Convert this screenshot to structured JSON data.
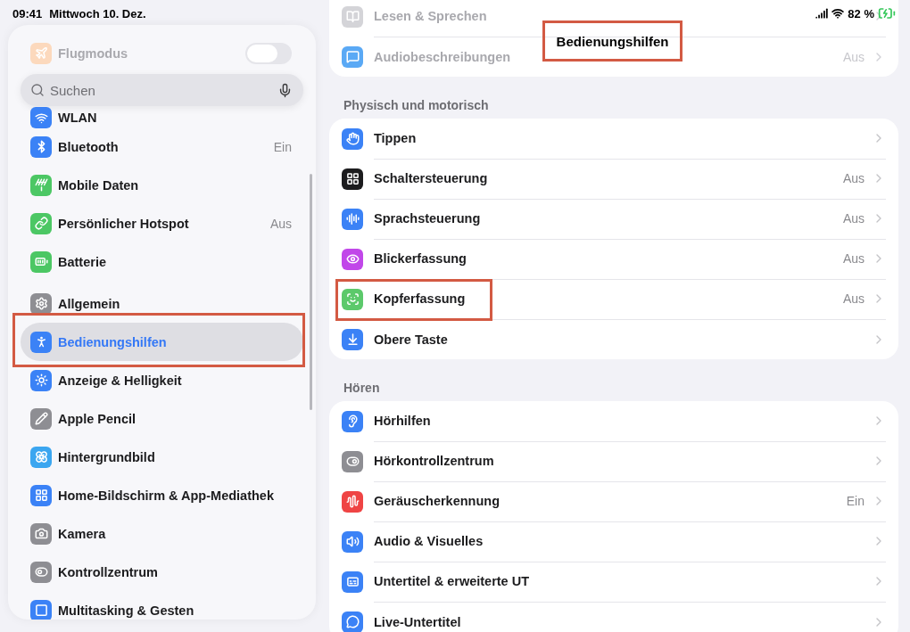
{
  "status_bar": {
    "time": "09:41",
    "date": "Mittwoch 10. Dez.",
    "battery": "82 %"
  },
  "sidebar": {
    "search": {
      "placeholder": "Suchen"
    },
    "groups": [
      {
        "items": [
          {
            "kind": "toggle",
            "label": "Flugmodus",
            "on": false,
            "dimmed": true,
            "color": "#fcd9bd",
            "selected": false,
            "highlighted": false
          },
          {
            "kind": "link",
            "label": "WLAN",
            "dimmed": false,
            "color": "#3b82f6",
            "selected": false,
            "highlighted": false
          },
          {
            "kind": "link",
            "label": "Bluetooth",
            "value": "Ein",
            "dimmed": false,
            "color": "#3b82f6",
            "selected": false,
            "highlighted": false
          },
          {
            "kind": "link",
            "label": "Mobile Daten",
            "dimmed": false,
            "color": "#4cc764",
            "selected": false,
            "highlighted": false
          },
          {
            "kind": "link",
            "label": "Persönlicher Hotspot",
            "value": "Aus",
            "dimmed": false,
            "color": "#4cc764",
            "selected": false,
            "highlighted": false
          },
          {
            "kind": "link",
            "label": "Batterie",
            "dimmed": false,
            "color": "#4cc764",
            "selected": false,
            "highlighted": false
          }
        ]
      },
      {
        "items": [
          {
            "kind": "link",
            "label": "Allgemein",
            "dimmed": false,
            "color": "#8e8e93",
            "selected": false,
            "highlighted": false
          },
          {
            "kind": "link",
            "label": "Bedienungshilfen",
            "dimmed": false,
            "color": "#3b82f6",
            "selected": true,
            "highlighted": true
          },
          {
            "kind": "link",
            "label": "Anzeige & Helligkeit",
            "dimmed": false,
            "color": "#3b82f6",
            "selected": false,
            "highlighted": false
          },
          {
            "kind": "link",
            "label": "Apple Pencil",
            "dimmed": false,
            "color": "#8e8e93",
            "selected": false,
            "highlighted": false
          },
          {
            "kind": "link",
            "label": "Hintergrundbild",
            "dimmed": false,
            "color": "#3ba6f0",
            "selected": false,
            "highlighted": false
          },
          {
            "kind": "link",
            "label": "Home-Bildschirm & App-Mediathek",
            "dimmed": false,
            "color": "#3b82f6",
            "selected": false,
            "highlighted": false
          },
          {
            "kind": "link",
            "label": "Kamera",
            "dimmed": false,
            "color": "#8e8e93",
            "selected": false,
            "highlighted": false
          },
          {
            "kind": "link",
            "label": "Kontrollzentrum",
            "dimmed": false,
            "color": "#8e8e93",
            "selected": false,
            "highlighted": false
          },
          {
            "kind": "link",
            "label": "Multitasking & Gesten",
            "dimmed": false,
            "color": "#3b82f6",
            "selected": false,
            "highlighted": false
          }
        ]
      }
    ]
  },
  "detail": {
    "title": "Bedienungshilfen",
    "title_highlighted": true,
    "sections": [
      {
        "items": [
          {
            "label": "Lesen & Sprechen",
            "dimmed": true,
            "color": "#d4d4d8",
            "highlighted": false
          },
          {
            "label": "Audiobeschreibungen",
            "value": "Aus",
            "dimmed": true,
            "color": "#5aa9f5",
            "highlighted": false
          }
        ]
      },
      {
        "header": "Physisch und motorisch",
        "items": [
          {
            "label": "Tippen",
            "dimmed": false,
            "color": "#3b82f6",
            "highlighted": false
          },
          {
            "label": "Schaltersteuerung",
            "value": "Aus",
            "dimmed": false,
            "color": "#1c1c1e",
            "highlighted": false
          },
          {
            "label": "Sprachsteuerung",
            "value": "Aus",
            "dimmed": false,
            "color": "#3b82f6",
            "highlighted": false
          },
          {
            "label": "Blickerfassung",
            "value": "Aus",
            "dimmed": false,
            "color": "#c147e9",
            "highlighted": false
          },
          {
            "label": "Kopferfassung",
            "value": "Aus",
            "dimmed": false,
            "color": "#5cc96b",
            "highlighted": true
          },
          {
            "label": "Obere Taste",
            "dimmed": false,
            "color": "#3b82f6",
            "highlighted": false
          }
        ]
      },
      {
        "header": "Hören",
        "items": [
          {
            "label": "Hörhilfen",
            "dimmed": false,
            "color": "#3b82f6",
            "highlighted": false
          },
          {
            "label": "Hörkontrollzentrum",
            "dimmed": false,
            "color": "#8e8e93",
            "highlighted": false
          },
          {
            "label": "Geräuscherkennung",
            "value": "Ein",
            "dimmed": false,
            "color": "#ef4444",
            "highlighted": false
          },
          {
            "label": "Audio & Visuelles",
            "dimmed": false,
            "color": "#3b82f6",
            "highlighted": false
          },
          {
            "label": "Untertitel & erweiterte UT",
            "dimmed": false,
            "color": "#3b82f6",
            "highlighted": false
          },
          {
            "label": "Live-Untertitel",
            "dimmed": false,
            "color": "#3b82f6",
            "highlighted": false
          }
        ]
      }
    ]
  }
}
